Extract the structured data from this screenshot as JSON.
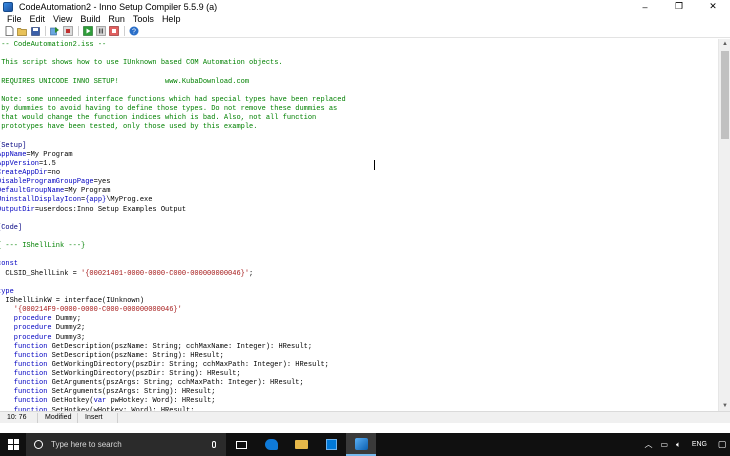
{
  "window": {
    "title": "CodeAutomation2 - Inno Setup Compiler 5.5.9 (a)",
    "controls": [
      "–",
      "❐",
      "✕"
    ]
  },
  "menu": [
    "File",
    "Edit",
    "View",
    "Build",
    "Run",
    "Tools",
    "Help"
  ],
  "toolbar": {
    "icons": [
      "new-file-icon",
      "open-file-icon",
      "save-icon",
      "compile-icon",
      "stop-compile-icon",
      "run-icon",
      "pause-icon",
      "stop-icon",
      "help-icon"
    ]
  },
  "editor": {
    "lines": [
      [
        {
          "c": "cm",
          "t": " -- CodeAutomation2.iss --"
        }
      ],
      [
        {
          "c": "cm",
          "t": ""
        }
      ],
      [
        {
          "c": "cm",
          "t": " This script shows how to use IUnknown based COM Automation objects."
        }
      ],
      [
        {
          "c": "cm",
          "t": ""
        }
      ],
      [
        {
          "c": "cm",
          "t": " REQUIRES UNICODE INNO SETUP!           www.KubaDownload.com"
        }
      ],
      [
        {
          "c": "cm",
          "t": ""
        }
      ],
      [
        {
          "c": "cm",
          "t": " Note: some unneeded interface functions which had special types have been replaced"
        }
      ],
      [
        {
          "c": "cm",
          "t": " by dummies to avoid having to define those types. Do not remove these dummies as"
        }
      ],
      [
        {
          "c": "cm",
          "t": " that would change the function indices which is bad. Also, not all function"
        }
      ],
      [
        {
          "c": "cm",
          "t": " prototypes have been tested, only those used by this example."
        }
      ],
      [
        {
          "c": "txt",
          "t": ""
        }
      ],
      [
        {
          "c": "sec",
          "t": "[Setup]"
        }
      ],
      [
        {
          "c": "key",
          "t": "AppName"
        },
        {
          "c": "txt",
          "t": "=My Program"
        }
      ],
      [
        {
          "c": "key",
          "t": "AppVersion"
        },
        {
          "c": "txt",
          "t": "=1.5"
        }
      ],
      [
        {
          "c": "key",
          "t": "CreateAppDir"
        },
        {
          "c": "txt",
          "t": "=no"
        }
      ],
      [
        {
          "c": "key",
          "t": "DisableProgramGroupPage"
        },
        {
          "c": "txt",
          "t": "=yes"
        }
      ],
      [
        {
          "c": "key",
          "t": "DefaultGroupName"
        },
        {
          "c": "txt",
          "t": "=My Program"
        }
      ],
      [
        {
          "c": "key",
          "t": "UninstallDisplayIcon"
        },
        {
          "c": "txt",
          "t": "="
        },
        {
          "c": "key",
          "t": "{app}"
        },
        {
          "c": "txt",
          "t": "\\MyProg.exe"
        }
      ],
      [
        {
          "c": "key",
          "t": "OutputDir"
        },
        {
          "c": "txt",
          "t": "=userdocs:Inno Setup Examples Output"
        }
      ],
      [
        {
          "c": "txt",
          "t": ""
        }
      ],
      [
        {
          "c": "sec",
          "t": "[Code]"
        }
      ],
      [
        {
          "c": "txt",
          "t": ""
        }
      ],
      [
        {
          "c": "cm",
          "t": "{ --- IShellLink ---}"
        }
      ],
      [
        {
          "c": "txt",
          "t": ""
        }
      ],
      [
        {
          "c": "kw",
          "t": "const"
        }
      ],
      [
        {
          "c": "txt",
          "t": "  CLSID_ShellLink = "
        },
        {
          "c": "str",
          "t": "'{00021401-0000-0000-C000-000000000046}'"
        },
        {
          "c": "txt",
          "t": ";"
        }
      ],
      [
        {
          "c": "txt",
          "t": ""
        }
      ],
      [
        {
          "c": "kw",
          "t": "type"
        }
      ],
      [
        {
          "c": "txt",
          "t": "  IShellLinkW = interface(IUnknown)"
        }
      ],
      [
        {
          "c": "str",
          "t": "    '{000214F9-0000-0000-C000-000000000046}'"
        }
      ],
      [
        {
          "c": "kw",
          "t": "    procedure"
        },
        {
          "c": "txt",
          "t": " Dummy;"
        }
      ],
      [
        {
          "c": "kw",
          "t": "    procedure"
        },
        {
          "c": "txt",
          "t": " Dummy2;"
        }
      ],
      [
        {
          "c": "kw",
          "t": "    procedure"
        },
        {
          "c": "txt",
          "t": " Dummy3;"
        }
      ],
      [
        {
          "c": "kw",
          "t": "    function"
        },
        {
          "c": "txt",
          "t": " GetDescription(pszName: String; cchMaxName: Integer): HResult;"
        }
      ],
      [
        {
          "c": "kw",
          "t": "    function"
        },
        {
          "c": "txt",
          "t": " SetDescription(pszName: String): HResult;"
        }
      ],
      [
        {
          "c": "kw",
          "t": "    function"
        },
        {
          "c": "txt",
          "t": " GetWorkingDirectory(pszDir: String; cchMaxPath: Integer): HResult;"
        }
      ],
      [
        {
          "c": "kw",
          "t": "    function"
        },
        {
          "c": "txt",
          "t": " SetWorkingDirectory(pszDir: String): HResult;"
        }
      ],
      [
        {
          "c": "kw",
          "t": "    function"
        },
        {
          "c": "txt",
          "t": " GetArguments(pszArgs: String; cchMaxPath: Integer): HResult;"
        }
      ],
      [
        {
          "c": "kw",
          "t": "    function"
        },
        {
          "c": "txt",
          "t": " SetArguments(pszArgs: String): HResult;"
        }
      ],
      [
        {
          "c": "kw",
          "t": "    function"
        },
        {
          "c": "txt",
          "t": " GetHotkey("
        },
        {
          "c": "kw",
          "t": "var"
        },
        {
          "c": "txt",
          "t": " pwHotkey: Word): HResult;"
        }
      ],
      [
        {
          "c": "kw",
          "t": "    function"
        },
        {
          "c": "txt",
          "t": " SetHotkey(wHotkey: Word): HResult;"
        }
      ]
    ]
  },
  "status": {
    "position": "10:  76",
    "modified": "Modified",
    "insert": "Insert"
  },
  "taskbar": {
    "search_placeholder": "Type here to search",
    "language": "ENG"
  }
}
